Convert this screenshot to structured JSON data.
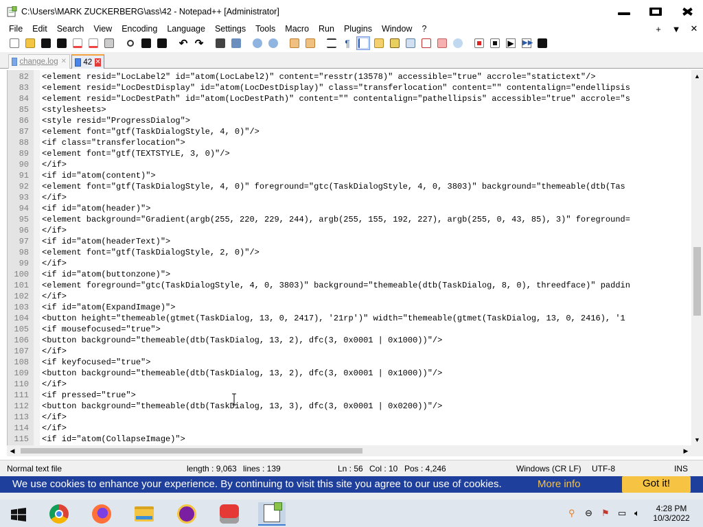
{
  "window": {
    "title": "C:\\Users\\MARK ZUCKERBERG\\ass\\42 - Notepad++ [Administrator]"
  },
  "menu": {
    "items": [
      "File",
      "Edit",
      "Search",
      "View",
      "Encoding",
      "Language",
      "Settings",
      "Tools",
      "Macro",
      "Run",
      "Plugins",
      "Window",
      "?"
    ],
    "right": [
      "+",
      "▼",
      "✕"
    ]
  },
  "tabs": [
    {
      "label": "change.log",
      "active": false
    },
    {
      "label": "42",
      "active": true
    }
  ],
  "editor": {
    "lines": [
      {
        "n": "82",
        "t": "<element resid=\"LocLabel2\" id=\"atom(LocLabel2)\" content=\"resstr(13578)\" accessible=\"true\" accrole=\"statictext\"/>"
      },
      {
        "n": "83",
        "t": "<element resid=\"LocDestDisplay\" id=\"atom(LocDestDisplay)\" class=\"transferlocation\" content=\"\" contentalign=\"endellipsis"
      },
      {
        "n": "84",
        "t": "<element resid=\"LocDestPath\" id=\"atom(LocDestPath)\" content=\"\" contentalign=\"pathellipsis\" accessible=\"true\" accrole=\"s"
      },
      {
        "n": "85",
        "t": "<stylesheets>"
      },
      {
        "n": "86",
        "t": "<style resid=\"ProgressDialog\">"
      },
      {
        "n": "87",
        "t": "<element font=\"gtf(TaskDialogStyle, 4, 0)\"/>"
      },
      {
        "n": "88",
        "t": "<if class=\"transferlocation\">"
      },
      {
        "n": "89",
        "t": "<element font=\"gtf(TEXTSTYLE, 3, 0)\"/>"
      },
      {
        "n": "90",
        "t": "</if>"
      },
      {
        "n": "91",
        "t": "<if id=\"atom(content)\">"
      },
      {
        "n": "92",
        "t": "<element font=\"gtf(TaskDialogStyle, 4, 0)\" foreground=\"gtc(TaskDialogStyle, 4, 0, 3803)\" background=\"themeable(dtb(Tas"
      },
      {
        "n": "93",
        "t": "</if>"
      },
      {
        "n": "94",
        "t": "<if id=\"atom(header)\">"
      },
      {
        "n": "95",
        "t": "<element background=\"Gradient(argb(255, 220, 229, 244), argb(255, 155, 192, 227), argb(255, 0, 43, 85), 3)\" foreground="
      },
      {
        "n": "96",
        "t": "</if>"
      },
      {
        "n": "97",
        "t": "<if id=\"atom(headerText)\">"
      },
      {
        "n": "98",
        "t": "<element font=\"gtf(TaskDialogStyle, 2, 0)\"/>"
      },
      {
        "n": "99",
        "t": "</if>"
      },
      {
        "n": "100",
        "t": "<if id=\"atom(buttonzone)\">"
      },
      {
        "n": "101",
        "t": "<element foreground=\"gtc(TaskDialogStyle, 4, 0, 3803)\" background=\"themeable(dtb(TaskDialog, 8, 0), threedface)\" paddin"
      },
      {
        "n": "102",
        "t": "</if>"
      },
      {
        "n": "103",
        "t": "<if id=\"atom(ExpandImage)\">"
      },
      {
        "n": "104",
        "t": "<button height=\"themeable(gtmet(TaskDialog, 13, 0, 2417), '21rp')\" width=\"themeable(gtmet(TaskDialog, 13, 0, 2416), '1"
      },
      {
        "n": "105",
        "t": "<if mousefocused=\"true\">"
      },
      {
        "n": "106",
        "t": "<button background=\"themeable(dtb(TaskDialog, 13, 2), dfc(3, 0x0001 | 0x1000))\"/>"
      },
      {
        "n": "107",
        "t": "</if>"
      },
      {
        "n": "108",
        "t": "<if keyfocused=\"true\">"
      },
      {
        "n": "109",
        "t": "<button background=\"themeable(dtb(TaskDialog, 13, 2), dfc(3, 0x0001 | 0x1000))\"/>"
      },
      {
        "n": "110",
        "t": "</if>"
      },
      {
        "n": "111",
        "t": "<if pressed=\"true\">"
      },
      {
        "n": "112",
        "t": "<button background=\"themeable(dtb(TaskDialog, 13, 3), dfc(3, 0x0001 | 0x0200))\"/>"
      },
      {
        "n": "113",
        "t": "</if>"
      },
      {
        "n": "114",
        "t": "</if>"
      },
      {
        "n": "115",
        "t": "<if id=\"atom(CollapseImage)\">"
      }
    ]
  },
  "status": {
    "file_type": "Normal text file",
    "length": "length : 9,063",
    "lines": "lines : 139",
    "ln": "Ln : 56",
    "col": "Col : 10",
    "pos": "Pos : 4,246",
    "eol": "Windows (CR LF)",
    "encoding": "UTF-8",
    "mode": "INS"
  },
  "cookie": {
    "message": "We use cookies to enhance your experience. By continuing to visit this site you agree to our use of cookies.",
    "more": "More info",
    "accept": "Got it!"
  },
  "taskbar": {
    "apps": [
      "chrome-icon",
      "firefox-icon",
      "file-explorer-icon",
      "yahoo-icon",
      "angry-birds-icon",
      "notepad-plus-plus-icon"
    ],
    "time": "4:28 PM",
    "date": "10/3/2022"
  },
  "colors": {
    "cookie_bg": "#1e3f9c",
    "accent_yellow": "#f6c343",
    "tab_close": "#e53935"
  }
}
